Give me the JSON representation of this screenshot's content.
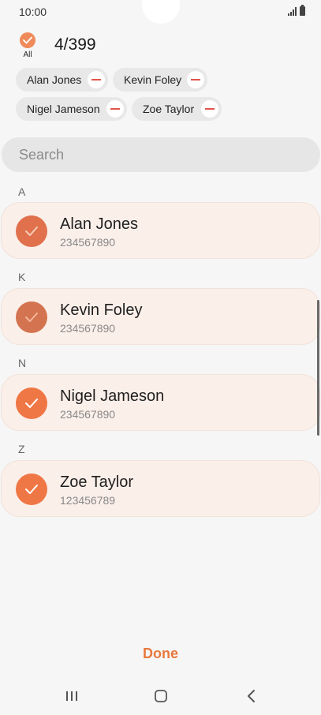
{
  "status_bar": {
    "time": "10:00",
    "icons": [
      "signal-icon",
      "battery-icon"
    ]
  },
  "header": {
    "select_all_label": "All",
    "selected_count": "4/399"
  },
  "chips": [
    {
      "label": "Alan Jones"
    },
    {
      "label": "Kevin Foley"
    },
    {
      "label": "Nigel Jameson"
    },
    {
      "label": "Zoe Taylor"
    }
  ],
  "search": {
    "placeholder": "Search"
  },
  "sections": [
    {
      "letter": "A",
      "contact": {
        "name": "Alan Jones",
        "phone": "234567890",
        "checked": true
      }
    },
    {
      "letter": "K",
      "contact": {
        "name": "Kevin Foley",
        "phone": "234567890",
        "checked": true
      }
    },
    {
      "letter": "N",
      "contact": {
        "name": "Nigel Jameson",
        "phone": "234567890",
        "checked": true
      }
    },
    {
      "letter": "Z",
      "contact": {
        "name": "Zoe Taylor",
        "phone": "123456789",
        "checked": true
      }
    }
  ],
  "footer": {
    "done_label": "Done"
  },
  "nav_bar": {
    "icons": [
      "recents-icon",
      "home-icon",
      "back-icon"
    ]
  },
  "colors": {
    "accent": "#e8793d",
    "check_fill": "#e5734a",
    "card_bg": "#fbefe9",
    "remove_red": "#e2554a"
  }
}
